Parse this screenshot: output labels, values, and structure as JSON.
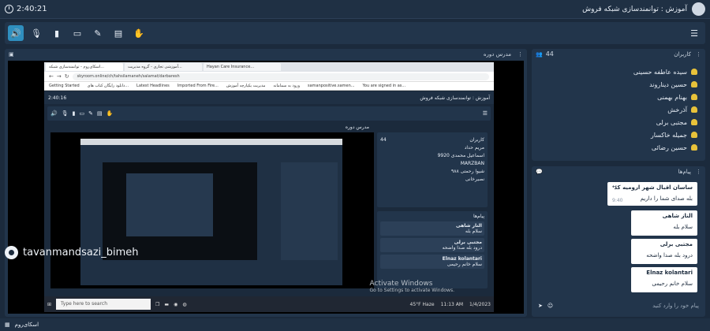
{
  "topbar": {
    "time": "2:40:21",
    "title": "آموزش : توانمندسازی شبکه فروش"
  },
  "toolbar": {
    "buttons": [
      "speaker-icon",
      "mic-off-icon",
      "camera-off-icon",
      "screen-share-icon",
      "pen-icon",
      "board-icon",
      "hand-icon"
    ]
  },
  "presenter": {
    "title": "مدرس دوره"
  },
  "screenshare": {
    "tabs": [
      "اسکای‌روم - توانمندسازی شبکه...",
      "آموزشی تجاری - گروه مدیریت...",
      "Hayan Care Insurance..."
    ],
    "url": "skyroom.online/ch/tahsilamaneh/salamat/darbaresh",
    "bookmarks": [
      "Getting Started",
      "دانلود رایگان کتاب های...",
      "Latest Headlines",
      "Imported From Fire...",
      "مدیریت یکپارچه آموزش",
      "ورود به سمامانه",
      "samanpositive.samen...",
      "You are signed in as..."
    ],
    "inner_time": "2:40:16",
    "inner_title": "آموزش : توانمندسازی شبکه فروش",
    "inner_presenter": "مدرس دوره",
    "inner_users_count": "44",
    "inner_users": [
      "مریم حداد",
      "اسماعیل محمدی 9920",
      "MARZBAN",
      "شیوا رحمتی ۹۸۸",
      "نصیرخانی"
    ],
    "inner_msgs": [
      {
        "name": "النار شاهی",
        "body": "سلام بله"
      },
      {
        "name": "مجتبی برلی",
        "body": "درود بله صدا واضحه"
      },
      {
        "name": "Elnaz kolantari",
        "body": "سلام خانم رحیمی"
      }
    ],
    "activate_title": "Activate Windows",
    "activate_sub": "Go to Settings to activate Windows.",
    "search_placeholder": "Type here to search",
    "weather": "45°F Haze",
    "clock": "11:13 AM",
    "date": "1/4/2023"
  },
  "watermark": "tavanmandsazi_bimeh",
  "users": {
    "title": "کاربران",
    "count": "44",
    "list": [
      "سیده عاطفه حسینی",
      "حسین دیناروند",
      "بهنام بهمنی",
      "آذرخش",
      "مجتبی برلی",
      "جمیله خاکسار",
      "حسین رضائی"
    ]
  },
  "messages": {
    "title": "پیام‌ها",
    "items": [
      {
        "name": "ساسان اقبال شهر ارومیه کد",
        "body": "بله صدای شما را داریم",
        "time": "9:40"
      },
      {
        "name": "الناز شاهی",
        "body": "سلام بله"
      },
      {
        "name": "مجتبی برلی",
        "body": "درود بله صدا واضحه"
      },
      {
        "name": "Elnaz kolantari",
        "body": "سلام خانم رحیمی"
      }
    ],
    "placeholder": "پیام خود را وارد کنید"
  },
  "footer": {
    "brand": "اسکای‌روم"
  }
}
